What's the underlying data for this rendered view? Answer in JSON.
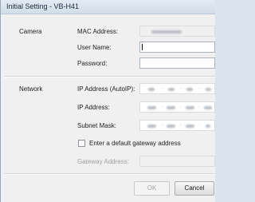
{
  "window": {
    "title": "Initial Setting - VB-H41"
  },
  "camera": {
    "section": "Camera",
    "mac_label": "MAC Address:",
    "user_label": "User Name:",
    "user_value": "",
    "password_label": "Password:",
    "password_value": ""
  },
  "network": {
    "section": "Network",
    "autoip_label": "IP Address (AutoIP):",
    "ip_label": "IP Address:",
    "subnet_label": "Subnet Mask:",
    "gateway_checkbox_label": "Enter a default gateway address",
    "gateway_checked": false,
    "gateway_label": "Gateway Address:",
    "gateway_value_dots": ".     .     ."
  },
  "buttons": {
    "ok": "OK",
    "cancel": "Cancel"
  }
}
